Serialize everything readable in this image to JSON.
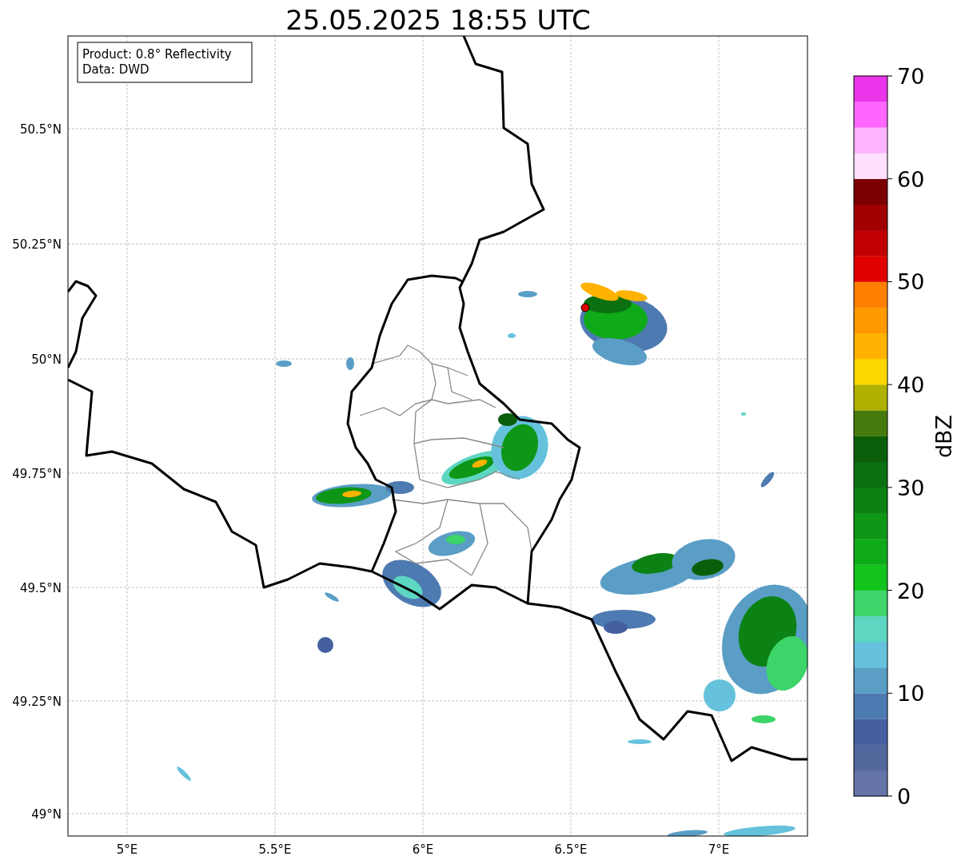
{
  "title": "25.05.2025 18:55 UTC",
  "info_box": [
    "Product: 0.8° Reflectivity",
    "Data: DWD"
  ],
  "y_ticks": [
    {
      "label": "50.5°N"
    },
    {
      "label": "50.25°N"
    },
    {
      "label": "50°N"
    },
    {
      "label": "49.75°N"
    },
    {
      "label": "49.5°N"
    },
    {
      "label": "49.25°N"
    },
    {
      "label": "49°N"
    }
  ],
  "x_ticks": [
    {
      "label": "5°E"
    },
    {
      "label": "5.5°E"
    },
    {
      "label": "6°E"
    },
    {
      "label": "6.5°E"
    },
    {
      "label": "7°E"
    }
  ],
  "colorbar": {
    "label": "dBZ",
    "ticks": [
      "70",
      "60",
      "50",
      "40",
      "30",
      "20",
      "10",
      "0"
    ],
    "bins": [
      {
        "color": "#6474a8"
      },
      {
        "color": "#52679c"
      },
      {
        "color": "#4460a0"
      },
      {
        "color": "#4d7ab0"
      },
      {
        "color": "#5a9ec6"
      },
      {
        "color": "#66c2dc"
      },
      {
        "color": "#5dd6c2"
      },
      {
        "color": "#3dd46a"
      },
      {
        "color": "#12c31c"
      },
      {
        "color": "#0faa18"
      },
      {
        "color": "#0e9616"
      },
      {
        "color": "#0c8214"
      },
      {
        "color": "#0b7010"
      },
      {
        "color": "#0a5e0a"
      },
      {
        "color": "#477a0c"
      },
      {
        "color": "#afb000"
      },
      {
        "color": "#ffd700"
      },
      {
        "color": "#ffb300"
      },
      {
        "color": "#ff9900"
      },
      {
        "color": "#ff7f00"
      },
      {
        "color": "#e00000"
      },
      {
        "color": "#c00000"
      },
      {
        "color": "#a00000"
      },
      {
        "color": "#7a0000"
      },
      {
        "color": "#ffe0ff"
      },
      {
        "color": "#ffb3ff"
      },
      {
        "color": "#ff66ff"
      },
      {
        "color": "#ea35ea"
      }
    ]
  }
}
